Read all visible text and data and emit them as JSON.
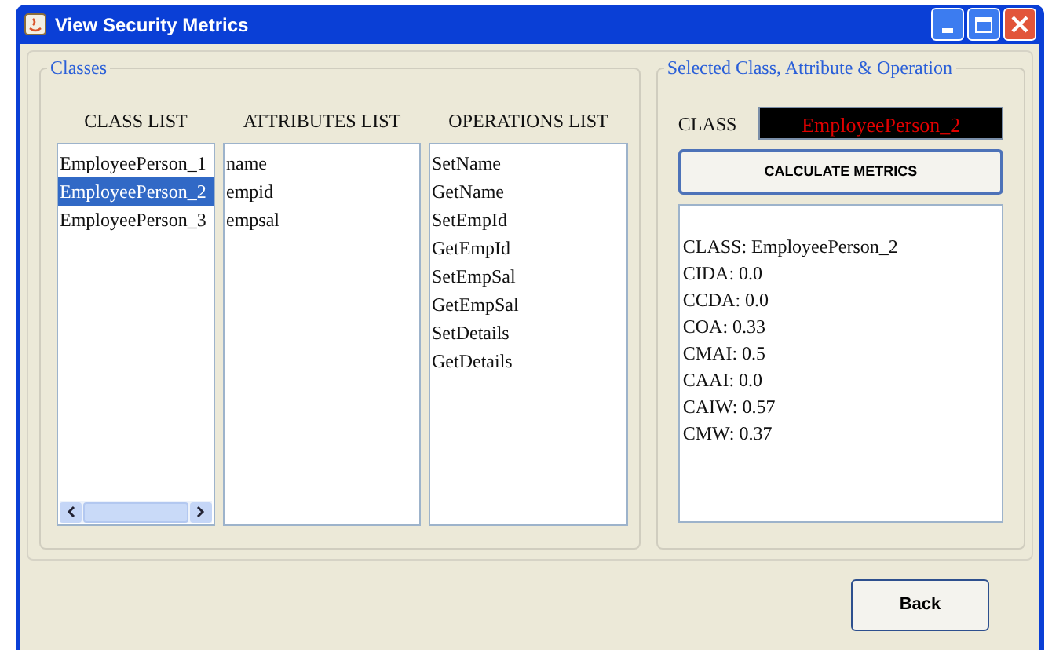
{
  "window": {
    "title": "View Security Metrics"
  },
  "classes_group": {
    "title": "Classes",
    "class_list": {
      "heading": "CLASS LIST",
      "items": [
        {
          "label": "EmployeePerson_1",
          "selected": false
        },
        {
          "label": "EmployeePerson_2",
          "selected": true
        },
        {
          "label": "EmployeePerson_3",
          "selected": false
        }
      ]
    },
    "attributes_list": {
      "heading": "ATTRIBUTES LIST",
      "items": [
        "name",
        "empid",
        "empsal"
      ]
    },
    "operations_list": {
      "heading": "OPERATIONS LIST",
      "items": [
        "SetName",
        "GetName",
        "SetEmpId",
        "GetEmpId",
        "SetEmpSal",
        "GetEmpSal",
        "SetDetails",
        "GetDetails"
      ]
    }
  },
  "selection_group": {
    "title": "Selected Class, Attribute & Operation",
    "class_label": "CLASS",
    "class_value": "EmployeePerson_2",
    "calculate_button": "CALCULATE METRICS",
    "results": [
      "CLASS: EmployeePerson_2",
      "CIDA: 0.0",
      "CCDA: 0.0",
      "COA: 0.33",
      "CMAI: 0.5",
      "CAAI: 0.0",
      "CAIW: 0.57",
      "CMW: 0.37"
    ]
  },
  "buttons": {
    "back": "Back"
  }
}
